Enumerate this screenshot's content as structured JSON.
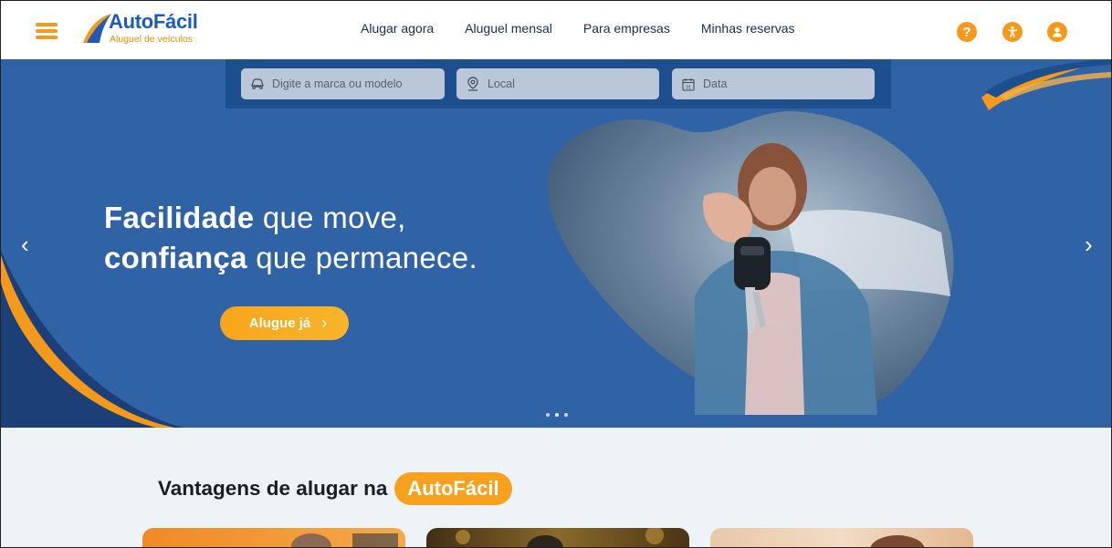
{
  "header": {
    "logo": {
      "name": "AutoFácil",
      "tagline": "Aluguel de veículos"
    },
    "nav": [
      {
        "label": "Alugar agora"
      },
      {
        "label": "Aluguel mensal"
      },
      {
        "label": "Para empresas"
      },
      {
        "label": "Minhas reservas"
      }
    ],
    "icons": [
      "help-icon",
      "accessibility-icon",
      "user-account-icon"
    ]
  },
  "search": {
    "model_placeholder": "Digite a marca ou modelo",
    "location_placeholder": "Local",
    "date_placeholder": "Data",
    "date_icon_text": "31"
  },
  "hero": {
    "headline_1_bold": "Facilidade",
    "headline_1_rest": " que move,",
    "headline_2_bold": "confiança",
    "headline_2_rest": " que permanece.",
    "cta_label": "Alugue já",
    "cta_arrow": "›",
    "prev_arrow": "‹",
    "next_arrow": "›",
    "slides": 3,
    "active_slide": 2
  },
  "advantages": {
    "title_prefix": "Vantagens de alugar na",
    "title_brand": "AutoFácil"
  },
  "colors": {
    "brand_blue": "#1e5bb8",
    "hero_blue": "#3063a5",
    "accent_orange": "#f39a1c"
  }
}
